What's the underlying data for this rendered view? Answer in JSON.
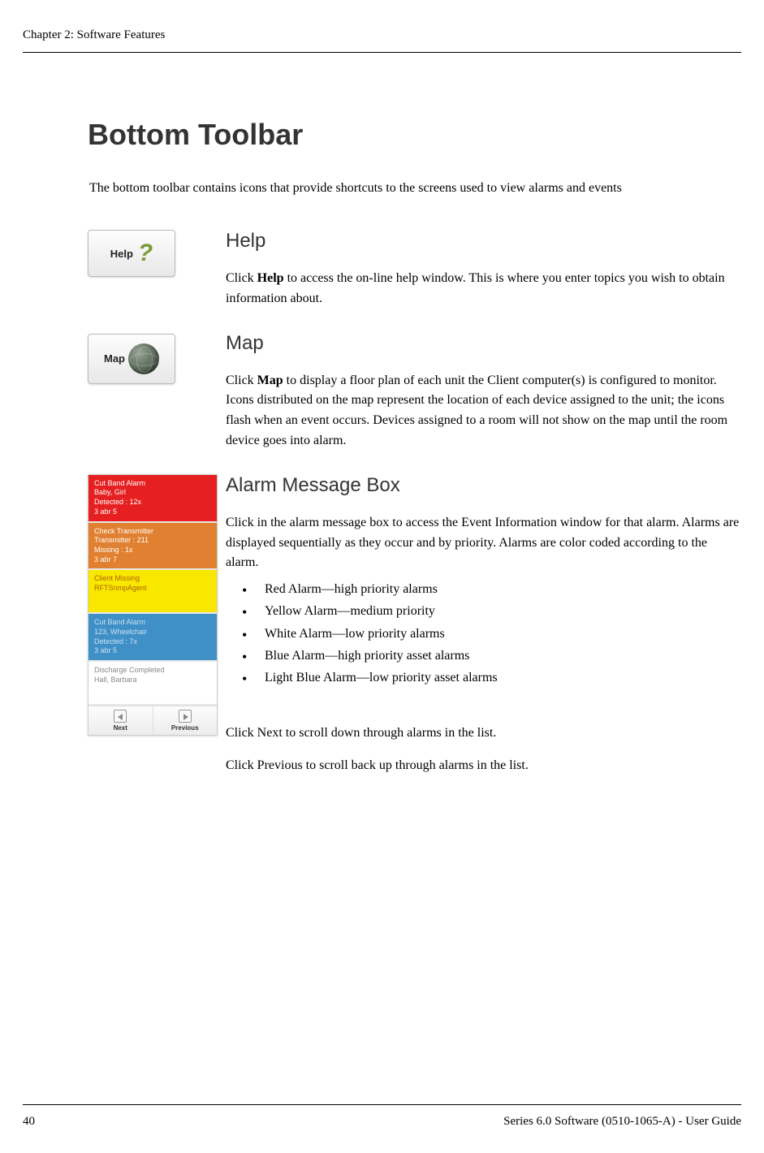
{
  "chapter": "Chapter 2: Software Features",
  "page_number": "40",
  "footer_right": "Series 6.0 Software (0510-1065-A) - User Guide",
  "title": "Bottom Toolbar",
  "intro": "The bottom toolbar contains icons that provide shortcuts to the screens used to view alarms and events",
  "help": {
    "button_label": "Help",
    "heading": "Help",
    "text_pre": "Click ",
    "text_bold": "Help",
    "text_post": " to access the on-line help window. This is where you enter topics you wish to obtain information about."
  },
  "map": {
    "button_label": "Map",
    "heading": "Map",
    "text_pre": "Click ",
    "text_bold": "Map",
    "text_post": " to display a floor plan of each unit the Client computer(s) is configured to monitor. Icons distributed on the map represent the location of each device assigned to the unit; the icons flash when an event occurs. Devices assigned to a room will not show on the map until the room device goes into alarm."
  },
  "alarm": {
    "heading": "Alarm Message Box",
    "intro": "Click in the alarm message box to access the Event Information window for that alarm. Alarms are displayed sequentially as they occur and by priority. Alarms are color coded according to the alarm.",
    "bullets": [
      "Red Alarm—high priority alarms",
      "Yellow Alarm—medium priority",
      "White Alarm—low priority alarms",
      "Blue Alarm—high priority asset alarms",
      "Light Blue Alarm—low priority asset alarms"
    ],
    "next_pre": "Click ",
    "next_bold": "Next",
    "next_post": " to scroll down through alarms in the list.",
    "prev_pre": "Click ",
    "prev_bold": "Previous",
    "prev_post": " to scroll back up through alarms in the list.",
    "items": {
      "red": {
        "l1": "Cut Band Alarm",
        "l2": "Baby, Girl",
        "l3": "Detected : 12x",
        "l4": "3 abr 5"
      },
      "orange": {
        "l1": "Check Transmitter",
        "l2": "Transmitter : 211",
        "l3": "Missing : 1x",
        "l4": "3 abr 7"
      },
      "yellow": {
        "l1": "Client Missing",
        "l2": "RFTSnmpAgent"
      },
      "blue": {
        "l1": "Cut Band Alarm",
        "l2": "123, Wheelchair",
        "l3": "Detected : 7x",
        "l4": "3 abr 5"
      },
      "white": {
        "l1": "Discharge Completed",
        "l2": "Hall, Barbara"
      }
    },
    "nav": {
      "next": "Next",
      "previous": "Previous"
    }
  }
}
